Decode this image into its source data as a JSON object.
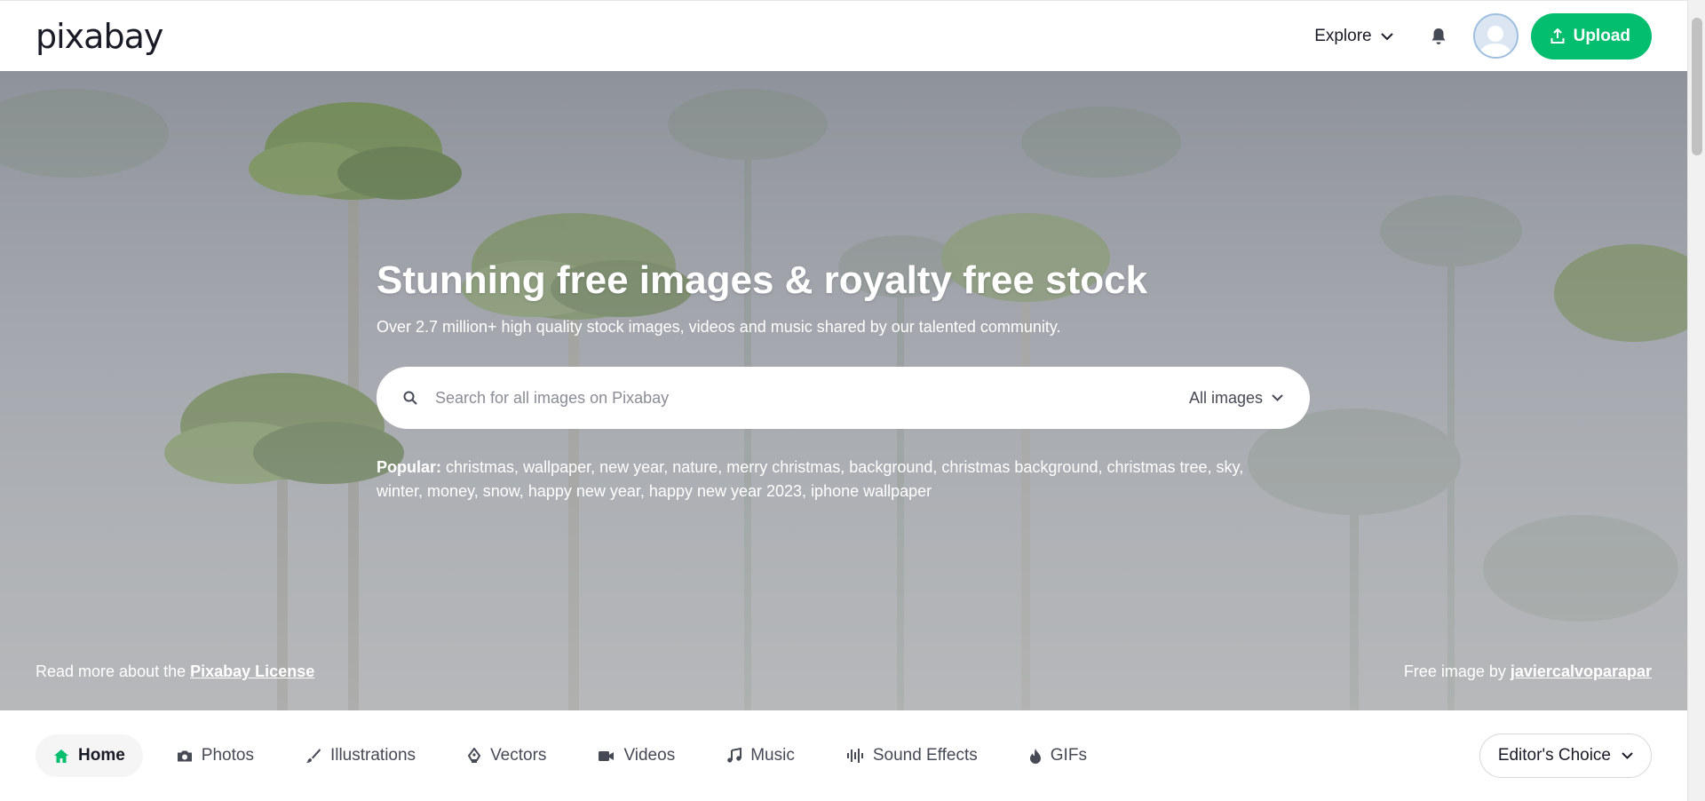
{
  "header": {
    "logo_text": "pixabay",
    "explore_label": "Explore",
    "upload_label": "Upload"
  },
  "hero": {
    "title": "Stunning free images & royalty free stock",
    "subtitle": "Over 2.7 million+ high quality stock images, videos and music shared by our talented community.",
    "search": {
      "placeholder": "Search for all images on Pixabay",
      "type_selected": "All images"
    },
    "popular": {
      "label": "Popular:",
      "tags": [
        "christmas",
        "wallpaper",
        "new year",
        "nature",
        "merry christmas",
        "background",
        "christmas background",
        "christmas tree",
        "sky",
        "winter",
        "money",
        "snow",
        "happy new year",
        "happy new year 2023",
        "iphone wallpaper"
      ]
    },
    "license": {
      "prefix": "Read more about the",
      "link": "Pixabay License"
    },
    "credit": {
      "prefix": "Free image by",
      "author": "javiercalvoparapar"
    }
  },
  "categories": {
    "items": [
      {
        "label": "Home",
        "icon": "home-icon",
        "active": true
      },
      {
        "label": "Photos",
        "icon": "camera-icon",
        "active": false
      },
      {
        "label": "Illustrations",
        "icon": "brush-icon",
        "active": false
      },
      {
        "label": "Vectors",
        "icon": "pen-nib-icon",
        "active": false
      },
      {
        "label": "Videos",
        "icon": "video-camera-icon",
        "active": false
      },
      {
        "label": "Music",
        "icon": "music-note-icon",
        "active": false
      },
      {
        "label": "Sound Effects",
        "icon": "sound-wave-icon",
        "active": false
      },
      {
        "label": "GIFs",
        "icon": "flame-icon",
        "active": false
      }
    ],
    "sort_label": "Editor's Choice"
  },
  "colors": {
    "brand_green": "#02be6e",
    "text_dark": "#191b26",
    "text_muted": "#464a55"
  }
}
